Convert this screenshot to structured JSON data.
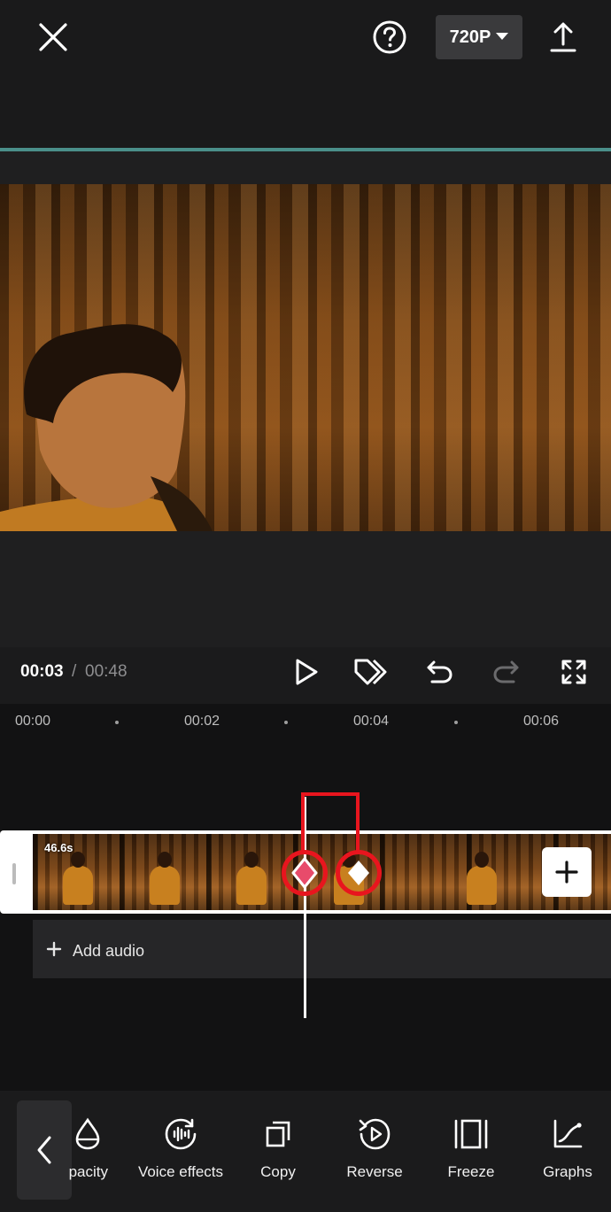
{
  "header": {
    "resolution_label": "720P"
  },
  "player": {
    "current_time": "00:03",
    "separator": "/",
    "total_time": "00:48"
  },
  "ruler": {
    "labels": [
      "00:00",
      "00:02",
      "00:04",
      "00:06"
    ]
  },
  "clip": {
    "duration": "46.6s"
  },
  "audio": {
    "add_label": "Add audio"
  },
  "toolbar": {
    "items": [
      {
        "label": "pacity",
        "icon": "opacity-icon"
      },
      {
        "label": "Voice effects",
        "icon": "voice-effects-icon"
      },
      {
        "label": "Copy",
        "icon": "copy-icon"
      },
      {
        "label": "Reverse",
        "icon": "reverse-icon"
      },
      {
        "label": "Freeze",
        "icon": "freeze-icon"
      },
      {
        "label": "Graphs",
        "icon": "graphs-icon"
      }
    ]
  },
  "colors": {
    "accent_line": "#4a8f8a",
    "annotation": "#e8151e",
    "keyframe_active": "#e84b6b"
  }
}
